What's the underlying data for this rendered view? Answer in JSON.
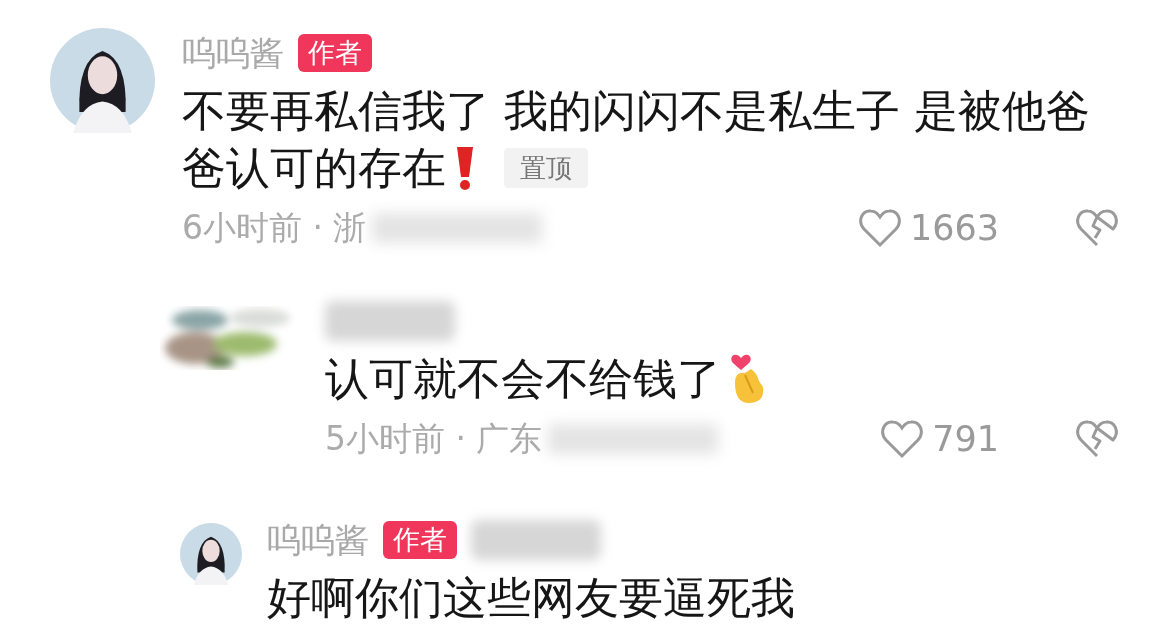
{
  "comments": [
    {
      "kind": "comment",
      "avatar": {
        "kind": "silhouette"
      },
      "author": "呜呜酱",
      "badge": "作者",
      "lines": [
        "不要再私信我了 我的闪闪不是私生子 是被他爸",
        "爸认可的存在"
      ],
      "trailing_icon": {
        "kind": "exclamation"
      },
      "tag": "置顶",
      "meta": "6小时前 · 浙",
      "redacted_meta": true,
      "likes": "1663"
    },
    {
      "kind": "reply",
      "avatar": {
        "kind": "blurred"
      },
      "redacted_author": true,
      "lines": [
        "认可就不会不给钱了"
      ],
      "trailing_icon": {
        "kind": "finger-heart"
      },
      "meta": "5小时前 · 广东",
      "redacted_meta": true,
      "likes": "791"
    },
    {
      "kind": "reply",
      "avatar": {
        "kind": "silhouette"
      },
      "author": "呜呜酱",
      "badge": "作者",
      "redacted_author": true,
      "lines": [
        "好啊你们这些网友要逼死我"
      ]
    }
  ]
}
